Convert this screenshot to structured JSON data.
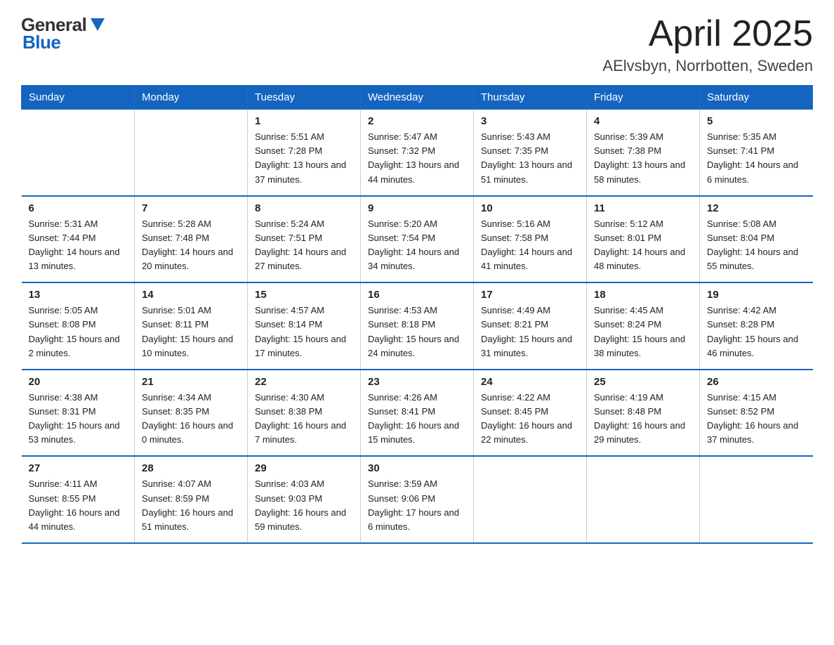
{
  "header": {
    "logo_general": "General",
    "logo_blue": "Blue",
    "title": "April 2025",
    "subtitle": "AElvsbyn, Norrbotten, Sweden"
  },
  "calendar": {
    "weekdays": [
      "Sunday",
      "Monday",
      "Tuesday",
      "Wednesday",
      "Thursday",
      "Friday",
      "Saturday"
    ],
    "rows": [
      [
        {
          "day": "",
          "info": ""
        },
        {
          "day": "",
          "info": ""
        },
        {
          "day": "1",
          "info": "Sunrise: 5:51 AM\nSunset: 7:28 PM\nDaylight: 13 hours\nand 37 minutes."
        },
        {
          "day": "2",
          "info": "Sunrise: 5:47 AM\nSunset: 7:32 PM\nDaylight: 13 hours\nand 44 minutes."
        },
        {
          "day": "3",
          "info": "Sunrise: 5:43 AM\nSunset: 7:35 PM\nDaylight: 13 hours\nand 51 minutes."
        },
        {
          "day": "4",
          "info": "Sunrise: 5:39 AM\nSunset: 7:38 PM\nDaylight: 13 hours\nand 58 minutes."
        },
        {
          "day": "5",
          "info": "Sunrise: 5:35 AM\nSunset: 7:41 PM\nDaylight: 14 hours\nand 6 minutes."
        }
      ],
      [
        {
          "day": "6",
          "info": "Sunrise: 5:31 AM\nSunset: 7:44 PM\nDaylight: 14 hours\nand 13 minutes."
        },
        {
          "day": "7",
          "info": "Sunrise: 5:28 AM\nSunset: 7:48 PM\nDaylight: 14 hours\nand 20 minutes."
        },
        {
          "day": "8",
          "info": "Sunrise: 5:24 AM\nSunset: 7:51 PM\nDaylight: 14 hours\nand 27 minutes."
        },
        {
          "day": "9",
          "info": "Sunrise: 5:20 AM\nSunset: 7:54 PM\nDaylight: 14 hours\nand 34 minutes."
        },
        {
          "day": "10",
          "info": "Sunrise: 5:16 AM\nSunset: 7:58 PM\nDaylight: 14 hours\nand 41 minutes."
        },
        {
          "day": "11",
          "info": "Sunrise: 5:12 AM\nSunset: 8:01 PM\nDaylight: 14 hours\nand 48 minutes."
        },
        {
          "day": "12",
          "info": "Sunrise: 5:08 AM\nSunset: 8:04 PM\nDaylight: 14 hours\nand 55 minutes."
        }
      ],
      [
        {
          "day": "13",
          "info": "Sunrise: 5:05 AM\nSunset: 8:08 PM\nDaylight: 15 hours\nand 2 minutes."
        },
        {
          "day": "14",
          "info": "Sunrise: 5:01 AM\nSunset: 8:11 PM\nDaylight: 15 hours\nand 10 minutes."
        },
        {
          "day": "15",
          "info": "Sunrise: 4:57 AM\nSunset: 8:14 PM\nDaylight: 15 hours\nand 17 minutes."
        },
        {
          "day": "16",
          "info": "Sunrise: 4:53 AM\nSunset: 8:18 PM\nDaylight: 15 hours\nand 24 minutes."
        },
        {
          "day": "17",
          "info": "Sunrise: 4:49 AM\nSunset: 8:21 PM\nDaylight: 15 hours\nand 31 minutes."
        },
        {
          "day": "18",
          "info": "Sunrise: 4:45 AM\nSunset: 8:24 PM\nDaylight: 15 hours\nand 38 minutes."
        },
        {
          "day": "19",
          "info": "Sunrise: 4:42 AM\nSunset: 8:28 PM\nDaylight: 15 hours\nand 46 minutes."
        }
      ],
      [
        {
          "day": "20",
          "info": "Sunrise: 4:38 AM\nSunset: 8:31 PM\nDaylight: 15 hours\nand 53 minutes."
        },
        {
          "day": "21",
          "info": "Sunrise: 4:34 AM\nSunset: 8:35 PM\nDaylight: 16 hours\nand 0 minutes."
        },
        {
          "day": "22",
          "info": "Sunrise: 4:30 AM\nSunset: 8:38 PM\nDaylight: 16 hours\nand 7 minutes."
        },
        {
          "day": "23",
          "info": "Sunrise: 4:26 AM\nSunset: 8:41 PM\nDaylight: 16 hours\nand 15 minutes."
        },
        {
          "day": "24",
          "info": "Sunrise: 4:22 AM\nSunset: 8:45 PM\nDaylight: 16 hours\nand 22 minutes."
        },
        {
          "day": "25",
          "info": "Sunrise: 4:19 AM\nSunset: 8:48 PM\nDaylight: 16 hours\nand 29 minutes."
        },
        {
          "day": "26",
          "info": "Sunrise: 4:15 AM\nSunset: 8:52 PM\nDaylight: 16 hours\nand 37 minutes."
        }
      ],
      [
        {
          "day": "27",
          "info": "Sunrise: 4:11 AM\nSunset: 8:55 PM\nDaylight: 16 hours\nand 44 minutes."
        },
        {
          "day": "28",
          "info": "Sunrise: 4:07 AM\nSunset: 8:59 PM\nDaylight: 16 hours\nand 51 minutes."
        },
        {
          "day": "29",
          "info": "Sunrise: 4:03 AM\nSunset: 9:03 PM\nDaylight: 16 hours\nand 59 minutes."
        },
        {
          "day": "30",
          "info": "Sunrise: 3:59 AM\nSunset: 9:06 PM\nDaylight: 17 hours\nand 6 minutes."
        },
        {
          "day": "",
          "info": ""
        },
        {
          "day": "",
          "info": ""
        },
        {
          "day": "",
          "info": ""
        }
      ]
    ]
  }
}
